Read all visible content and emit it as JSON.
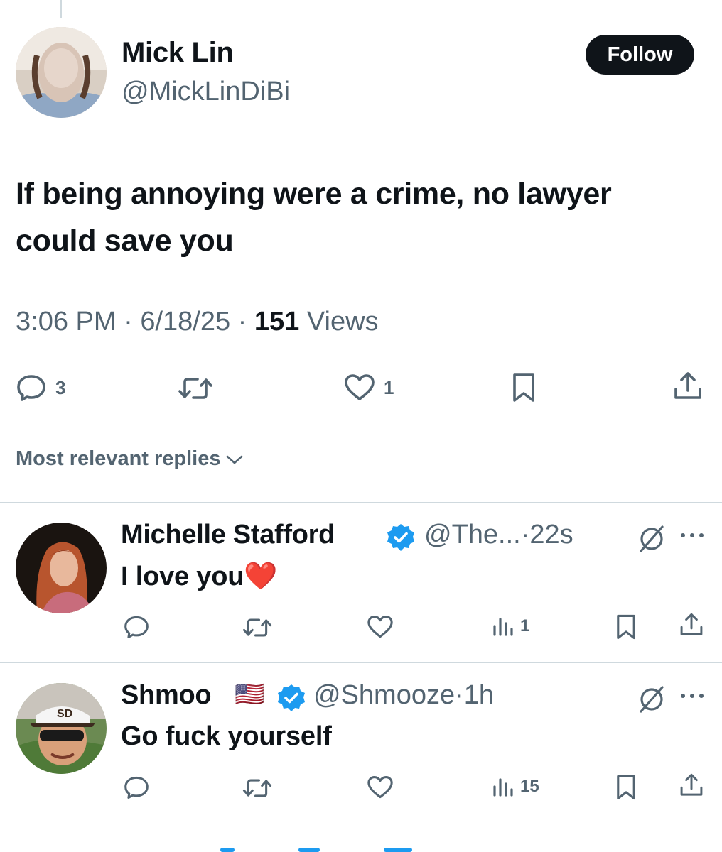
{
  "tweet": {
    "author_name": "Mick Lin",
    "author_handle": "@MickLinDiBi",
    "follow_label": "Follow",
    "text_line1": "If being annoying were a crime, no lawyer",
    "text_line2": "could save you",
    "time": "3:06 PM",
    "date": "6/18/25",
    "views_count": "151",
    "views_label": "Views",
    "separator": "·",
    "reply_count": "3",
    "like_count": "1"
  },
  "sort": {
    "label": "Most relevant replies"
  },
  "replies": [
    {
      "name": "Michelle Stafford",
      "handle": "@The...",
      "time": "22s",
      "text": "I love you",
      "emoji": "❤️",
      "views": "1"
    },
    {
      "name": "Shmoo",
      "flag": "🇺🇸",
      "handle": "@Shmooze",
      "time": "1h",
      "text": "Go fuck yourself",
      "views": "15"
    }
  ],
  "colors": {
    "text_primary": "#0f1419",
    "text_secondary": "#536471",
    "verified_blue": "#1d9bf0",
    "divider": "#cfd9de",
    "follow_bg": "#0f1419"
  },
  "icons": [
    "reply-icon",
    "retweet-icon",
    "like-icon",
    "bookmark-icon",
    "share-icon",
    "views-icon",
    "verified-badge-icon",
    "grok-icon",
    "more-icon",
    "chevron-down-icon"
  ]
}
